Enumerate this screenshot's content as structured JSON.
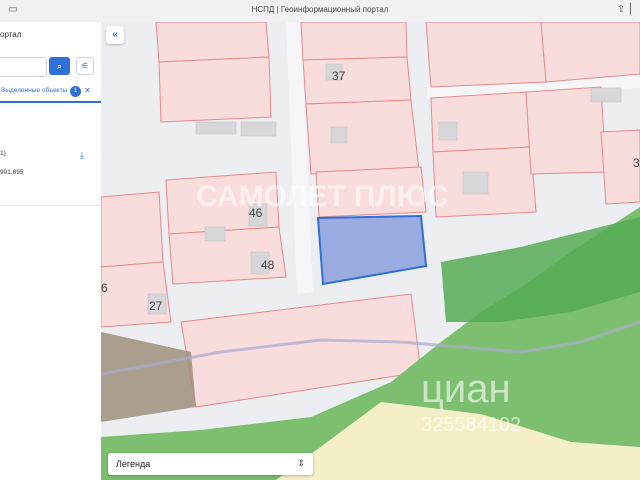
{
  "window": {
    "title": "НСПД | Геоинформационный портал"
  },
  "sidebar": {
    "title_fragment": "ортал",
    "search": {
      "value": "",
      "placeholder": ""
    },
    "tab": {
      "label": "Выделенные объекты",
      "count": "1"
    },
    "item": {
      "line1": "1)",
      "line2": "901.895"
    }
  },
  "map": {
    "plot_labels": [
      "37",
      "46",
      "48",
      "27",
      "6",
      "3"
    ],
    "watermark_portal": "САМОЛЕТ ПЛЮС",
    "watermark_cian": "циан",
    "watermark_id": "325584102",
    "selected_color": "#7f94d8",
    "parcel_fill": "#f9dcdc",
    "parcel_stroke": "#e88a8a"
  },
  "legend": {
    "label": "Легенда"
  },
  "icons": [
    "sidebar-icon",
    "share-icon",
    "search-icon",
    "filter-icon",
    "download-icon",
    "collapse-icon",
    "chevron-updown-icon",
    "close-icon"
  ]
}
